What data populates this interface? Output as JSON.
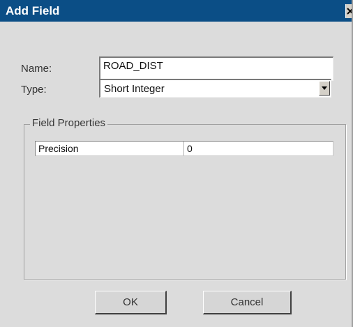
{
  "dialog": {
    "title": "Add Field",
    "close_icon": "close-icon"
  },
  "form": {
    "name_label": "Name:",
    "name_value": "ROAD_DIST",
    "type_label": "Type:",
    "type_value": "Short Integer"
  },
  "field_properties": {
    "legend": "Field Properties",
    "rows": [
      {
        "property": "Precision",
        "value": "0"
      }
    ]
  },
  "buttons": {
    "ok_label": "OK",
    "cancel_label": "Cancel"
  },
  "colors": {
    "titlebar": "#0b4e86",
    "dialog_background": "#dcdcdc"
  }
}
